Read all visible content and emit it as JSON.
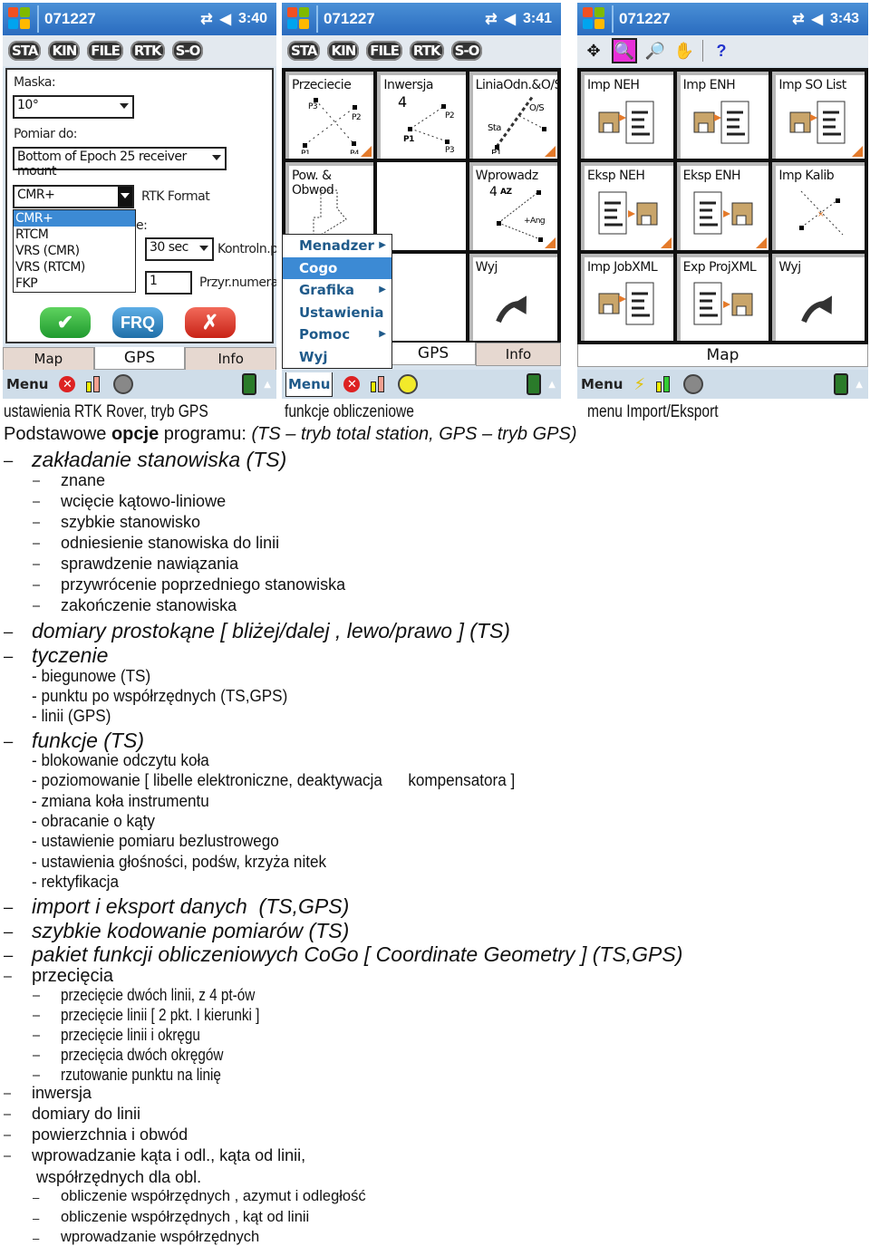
{
  "screens": [
    {
      "title": "071227",
      "time": "3:40",
      "toolbar": [
        "STA",
        "KIN",
        "FILE",
        "RTK",
        "S-O"
      ],
      "form": {
        "mask_label": "Maska:",
        "mask_value": "10°",
        "measure_to_label": "Pomiar do:",
        "measure_to_value": "Bottom of Epoch 25 receiver mount",
        "rtk_format_value": "CMR+",
        "rtk_format_label": "RTK Format",
        "rtk_format_options": [
          "CMR+",
          "RTCM",
          "VRS (CMR)",
          "VRS (RTCM)",
          "FKP"
        ],
        "hidden_label_tail": "e:",
        "interval_value": "30 sec",
        "interval_label": "Kontroln.p",
        "increment_value": "1",
        "increment_label": "Przyr.numera"
      },
      "buttons": {
        "ok": "✔",
        "frq": "FRQ",
        "cancel": "✗"
      },
      "tabs": [
        "Map",
        "GPS",
        "Info"
      ],
      "active_tab": "GPS",
      "bottom_menu": "Menu"
    },
    {
      "title": "071227",
      "time": "3:41",
      "toolbar": [
        "STA",
        "KIN",
        "FILE",
        "RTK",
        "S-O"
      ],
      "tiles": [
        "Przeciecie",
        "Inwersja",
        "LiniaOdn.&O/S",
        "Pow. & Obwod",
        "",
        "Wprowadz",
        "",
        "",
        "Wyj"
      ],
      "tile_glyphs": {
        "p1": "P1",
        "p2": "P2",
        "p3": "P3",
        "p4": "P4",
        "sta": "Sta",
        "os": "O/S",
        "az": "AZ",
        "ang": "+Ang"
      },
      "popup_menu": [
        {
          "label": "Menadzer",
          "submenu": true
        },
        {
          "label": "Cogo",
          "submenu": false,
          "selected": true
        },
        {
          "label": "Grafika",
          "submenu": true
        },
        {
          "label": "Ustawienia",
          "submenu": false
        },
        {
          "label": "Pomoc",
          "submenu": true
        },
        {
          "label": "Wyj",
          "submenu": false
        }
      ],
      "tabs": [
        "GPS",
        "Info"
      ],
      "bottom_menu": "Menu"
    },
    {
      "title": "071227",
      "time": "3:43",
      "toolbar_icons": [
        "pan-icon",
        "zoom-in-icon",
        "zoom-out-icon",
        "hand-icon",
        "help-icon"
      ],
      "tiles": [
        "Imp NEH",
        "Imp ENH",
        "Imp SO List",
        "Eksp NEH",
        "Eksp ENH",
        "Imp Kalib",
        "Imp JobXML",
        "Exp ProjXML",
        "Wyj"
      ],
      "tab": "Map",
      "bottom_menu": "Menu"
    }
  ],
  "captions": [
    "ustawienia RTK Rover, tryb GPS",
    "funkcje obliczeniowe",
    "menu Import/Eksport"
  ],
  "document": {
    "intro_prefix": "Podstawowe ",
    "intro_bold": "opcje",
    "intro_mid": " programu: ",
    "intro_italic": "(TS – tryb total station, GPS – tryb GPS)",
    "dash": "–",
    "lines": [
      {
        "level": "h",
        "text": "zakładanie stanowiska (TS)"
      },
      {
        "level": "s",
        "text": "znane"
      },
      {
        "level": "s",
        "text": "wcięcie kątowo-liniowe"
      },
      {
        "level": "s",
        "text": "szybkie stanowisko"
      },
      {
        "level": "s",
        "text": "odniesienie stanowiska do linii"
      },
      {
        "level": "s",
        "text": "sprawdzenie nawiązania"
      },
      {
        "level": "s",
        "text": "przywrócenie poprzedniego stanowiska"
      },
      {
        "level": "s",
        "text": "zakończenie stanowiska"
      },
      {
        "level": "h",
        "text": "domiary prostokąne [ bliżej/dalej , lewo/prawo ] (TS)"
      },
      {
        "level": "h",
        "text": "tyczenie"
      },
      {
        "level": "d",
        "text": "- biegunowe (TS)"
      },
      {
        "level": "d",
        "text": "- punktu po współrzędnych (TS,GPS)"
      },
      {
        "level": "d",
        "text": "- linii (GPS)"
      },
      {
        "level": "h",
        "text": "funkcje (TS)"
      },
      {
        "level": "d",
        "text": "- blokowanie odczytu koła"
      },
      {
        "level": "d",
        "text": "- poziomowanie [ libelle elektroniczne, deaktywacja      kompensatora ]"
      },
      {
        "level": "d",
        "text": "- zmiana koła instrumentu"
      },
      {
        "level": "d",
        "text": "- obracanie o kąty"
      },
      {
        "level": "d",
        "text": "- ustawienie pomiaru bezlustrowego"
      },
      {
        "level": "d",
        "text": "- ustawienia głośności, podśw, krzyża nitek"
      },
      {
        "level": "d",
        "text": "- rektyfikacja"
      },
      {
        "level": "h",
        "text": "import i eksport danych  (TS,GPS)"
      },
      {
        "level": "h",
        "text": "szybkie kodowanie pomiarów (TS)"
      },
      {
        "level": "h",
        "text": "pakiet funkcji obliczeniowych CoGo [ Coordinate Geometry ] (TS,GPS)"
      },
      {
        "level": "n",
        "text": "przecięcia"
      },
      {
        "level": "s",
        "text": "przecięcie dwóch linii, z 4 pt-ów"
      },
      {
        "level": "s",
        "text": "przecięcie linii [ 2 pkt. I kierunki ]"
      },
      {
        "level": "s",
        "text": "przecięcie linii i okręgu"
      },
      {
        "level": "s",
        "text": "przecięcia dwóch okręgów"
      },
      {
        "level": "s",
        "text": "rzutowanie punktu na linię"
      },
      {
        "level": "a",
        "text": "inwersja"
      },
      {
        "level": "a",
        "text": "domiary do linii"
      },
      {
        "level": "a",
        "text": "powierzchnia i obwód"
      },
      {
        "level": "a",
        "text": "wprowadzanie kąta i odl., kąta od linii,"
      },
      {
        "level": "ac",
        "text": "współrzędnych dla obl."
      },
      {
        "level": "as",
        "text": "obliczenie współrzędnych , azymut i odległość"
      },
      {
        "level": "as",
        "text": "obliczenie współrzędnych , kąt od linii"
      },
      {
        "level": "as",
        "text": "wprowadzanie współrzędnych"
      }
    ]
  }
}
